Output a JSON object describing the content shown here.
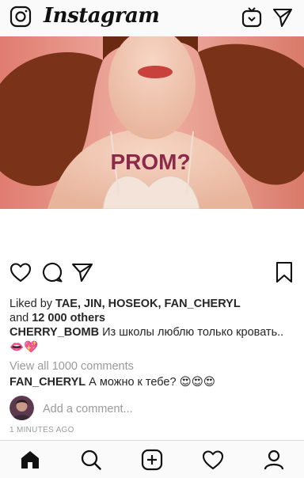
{
  "app": {
    "title": "Instagram"
  },
  "header": {
    "camera_icon": "camera-icon",
    "igtv_icon": "igtv-icon",
    "direct_icon": "paper-plane-icon"
  },
  "post": {
    "image_text": "PROM?",
    "likes": {
      "prefix": "Liked by ",
      "names": "TAE, JIN, HOSEOK, FAN_CHERYL",
      "and": "and ",
      "count": "12 000 others"
    },
    "caption": {
      "user": "CHERRY_BOMB",
      "text": " Из школы люблю только кровать.. 👄💖"
    },
    "view_all_comments": "View all 1000 comments",
    "comments": [
      {
        "user": "FAN_CHERYL",
        "text": " А можно к тебе? 😍😍😍"
      }
    ],
    "add_comment_placeholder": "Add a comment...",
    "time": "1 MINUTES AGO"
  },
  "actions": [
    "heart-icon",
    "comment-icon",
    "share-icon",
    "bookmark-icon"
  ],
  "tabbar": [
    "home-icon",
    "search-icon",
    "new-post-icon",
    "activity-icon",
    "profile-icon"
  ],
  "colors": {
    "text": "#262626",
    "muted": "#9a9a9a",
    "bar_bg": "#fafafa"
  }
}
